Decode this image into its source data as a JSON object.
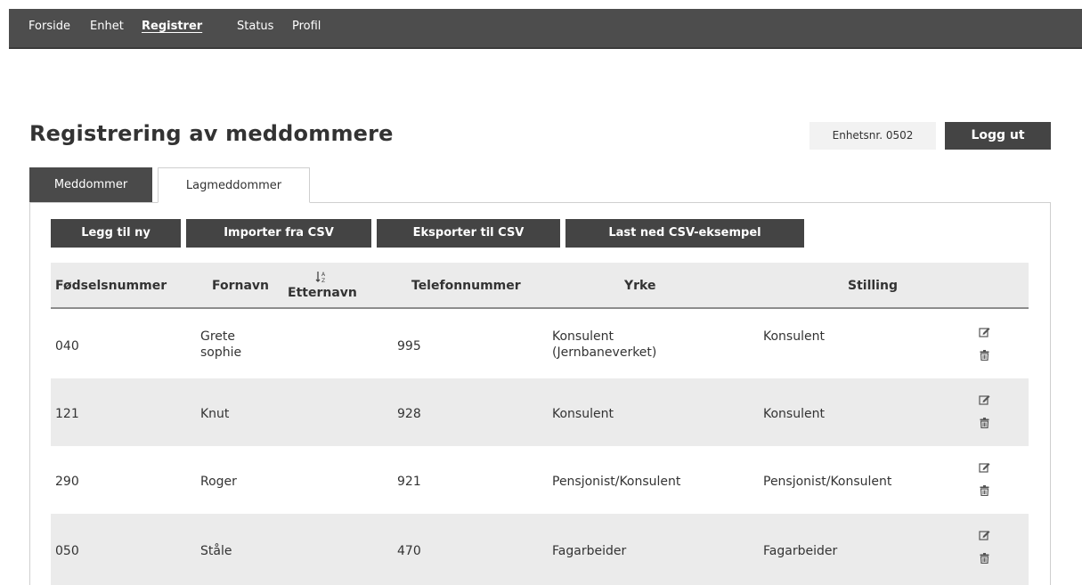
{
  "nav": {
    "items": [
      {
        "label": "Forside"
      },
      {
        "label": "Enhet"
      },
      {
        "label": "Registrer"
      },
      {
        "label": "Status"
      },
      {
        "label": "Profil"
      }
    ]
  },
  "header": {
    "title": "Registrering av meddommere",
    "unit": "Enhetsnr. 0502",
    "logout_label": "Logg ut"
  },
  "tabs": [
    {
      "label": "Meddommer"
    },
    {
      "label": "Lagmeddommer"
    }
  ],
  "actions": {
    "add_label": "Legg til ny",
    "import_label": "Importer fra CSV",
    "export_label": "Eksporter til CSV",
    "download_label": "Last ned CSV-eksempel"
  },
  "table": {
    "columns": {
      "fodselsnummer": "Fødselsnummer",
      "fornavn": "Fornavn",
      "etternavn": "Etternavn",
      "telefon": "Telefonnummer",
      "yrke": "Yrke",
      "stilling": "Stilling"
    },
    "sort_icon": "sort-arrows",
    "rows": [
      {
        "fnr": "040",
        "fornavn_1": "Grete",
        "fornavn_2": "sophie",
        "etternavn": "",
        "telefon": "995",
        "yrke_1": "Konsulent",
        "yrke_2": "(Jernbaneverket)",
        "stilling": "Konsulent"
      },
      {
        "fnr": "121",
        "fornavn_1": "Knut",
        "fornavn_2": "",
        "etternavn": "",
        "telefon": "928",
        "yrke_1": "Konsulent",
        "yrke_2": "",
        "stilling": "Konsulent"
      },
      {
        "fnr": "290",
        "fornavn_1": "Roger",
        "fornavn_2": "",
        "etternavn": "",
        "telefon": "921",
        "yrke_1": "Pensjonist/Konsulent",
        "yrke_2": "",
        "stilling": "Pensjonist/Konsulent"
      },
      {
        "fnr": "050",
        "fornavn_1": "Ståle",
        "fornavn_2": "",
        "etternavn": "",
        "telefon": "470",
        "yrke_1": "Fagarbeider",
        "yrke_2": "",
        "stilling": "Fagarbeider"
      }
    ]
  }
}
